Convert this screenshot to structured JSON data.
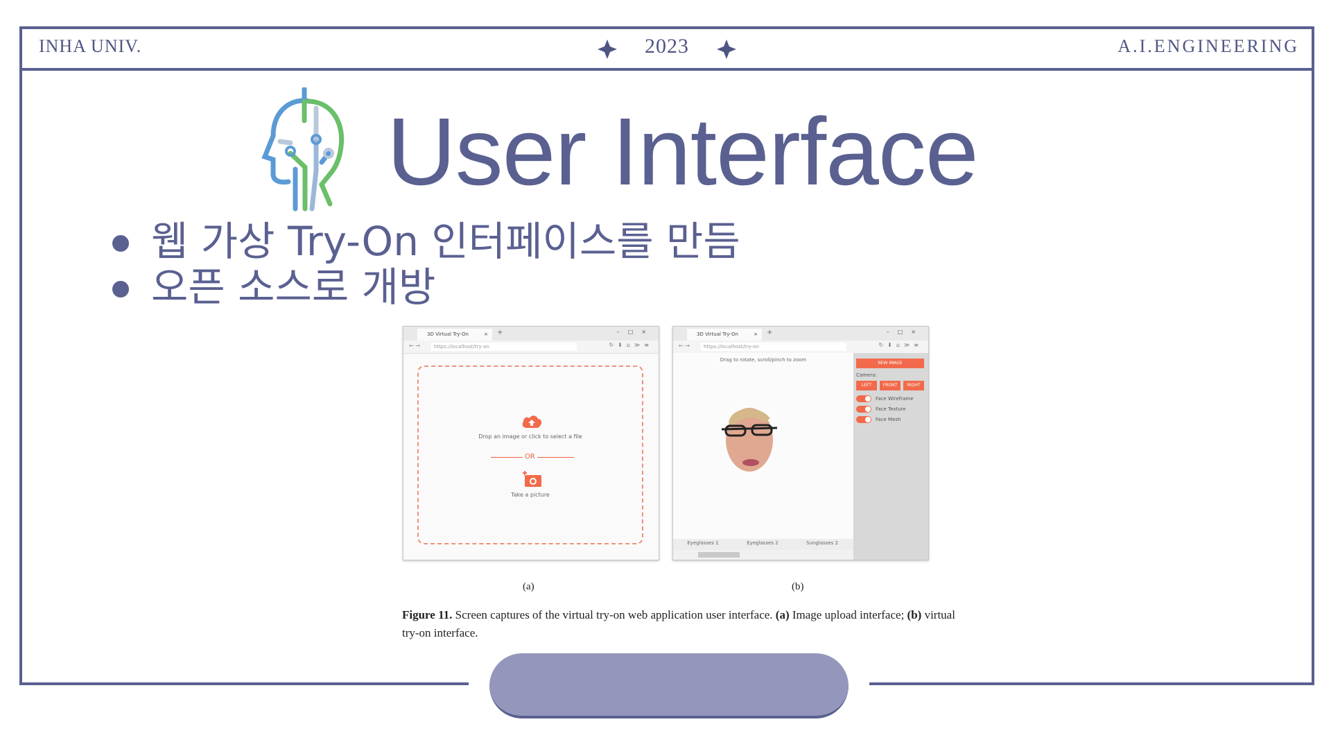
{
  "header": {
    "left": "INHA UNIV.",
    "year": "2023",
    "right": "A.I.ENGINEERING"
  },
  "slide": {
    "title": "User Interface",
    "bullets": [
      "웹 가상 Try-On 인터페이스를 만듬",
      "오픈 소스로 개방"
    ]
  },
  "figure": {
    "screen_a": {
      "tab_title": "3D Virtual Try-On",
      "url": "https://localhost/try-on",
      "drop_text": "Drop an image or click to select a file",
      "or_text": "OR",
      "take_picture": "Take a picture"
    },
    "screen_b": {
      "tab_title": "3D Virtual Try-On",
      "url": "https://localhost/try-on",
      "hint": "Drag to rotate, scroll/pinch to zoom",
      "new_image": "NEW IMAGE",
      "camera_label": "Camera:",
      "camera_buttons": [
        "LEFT",
        "FRONT",
        "RIGHT"
      ],
      "toggles": [
        "Face Wireframe",
        "Face Texture",
        "Face Mesh"
      ],
      "glasses": [
        "Eyeglasses 1",
        "Eyeglasses 2",
        "Sunglasses 2"
      ]
    },
    "label_a": "(a)",
    "label_b": "(b)",
    "caption_bold": "Figure 11.",
    "caption_text": "Screen captures of the virtual try-on web application user interface.",
    "caption_a_label": "(a)",
    "caption_a_text": "Image upload interface;",
    "caption_b_label": "(b)",
    "caption_b_text": "virtual try-on interface."
  },
  "colors": {
    "frame": "#5a6090",
    "accent_orange": "#f26a4b",
    "pill": "#9497bb"
  }
}
